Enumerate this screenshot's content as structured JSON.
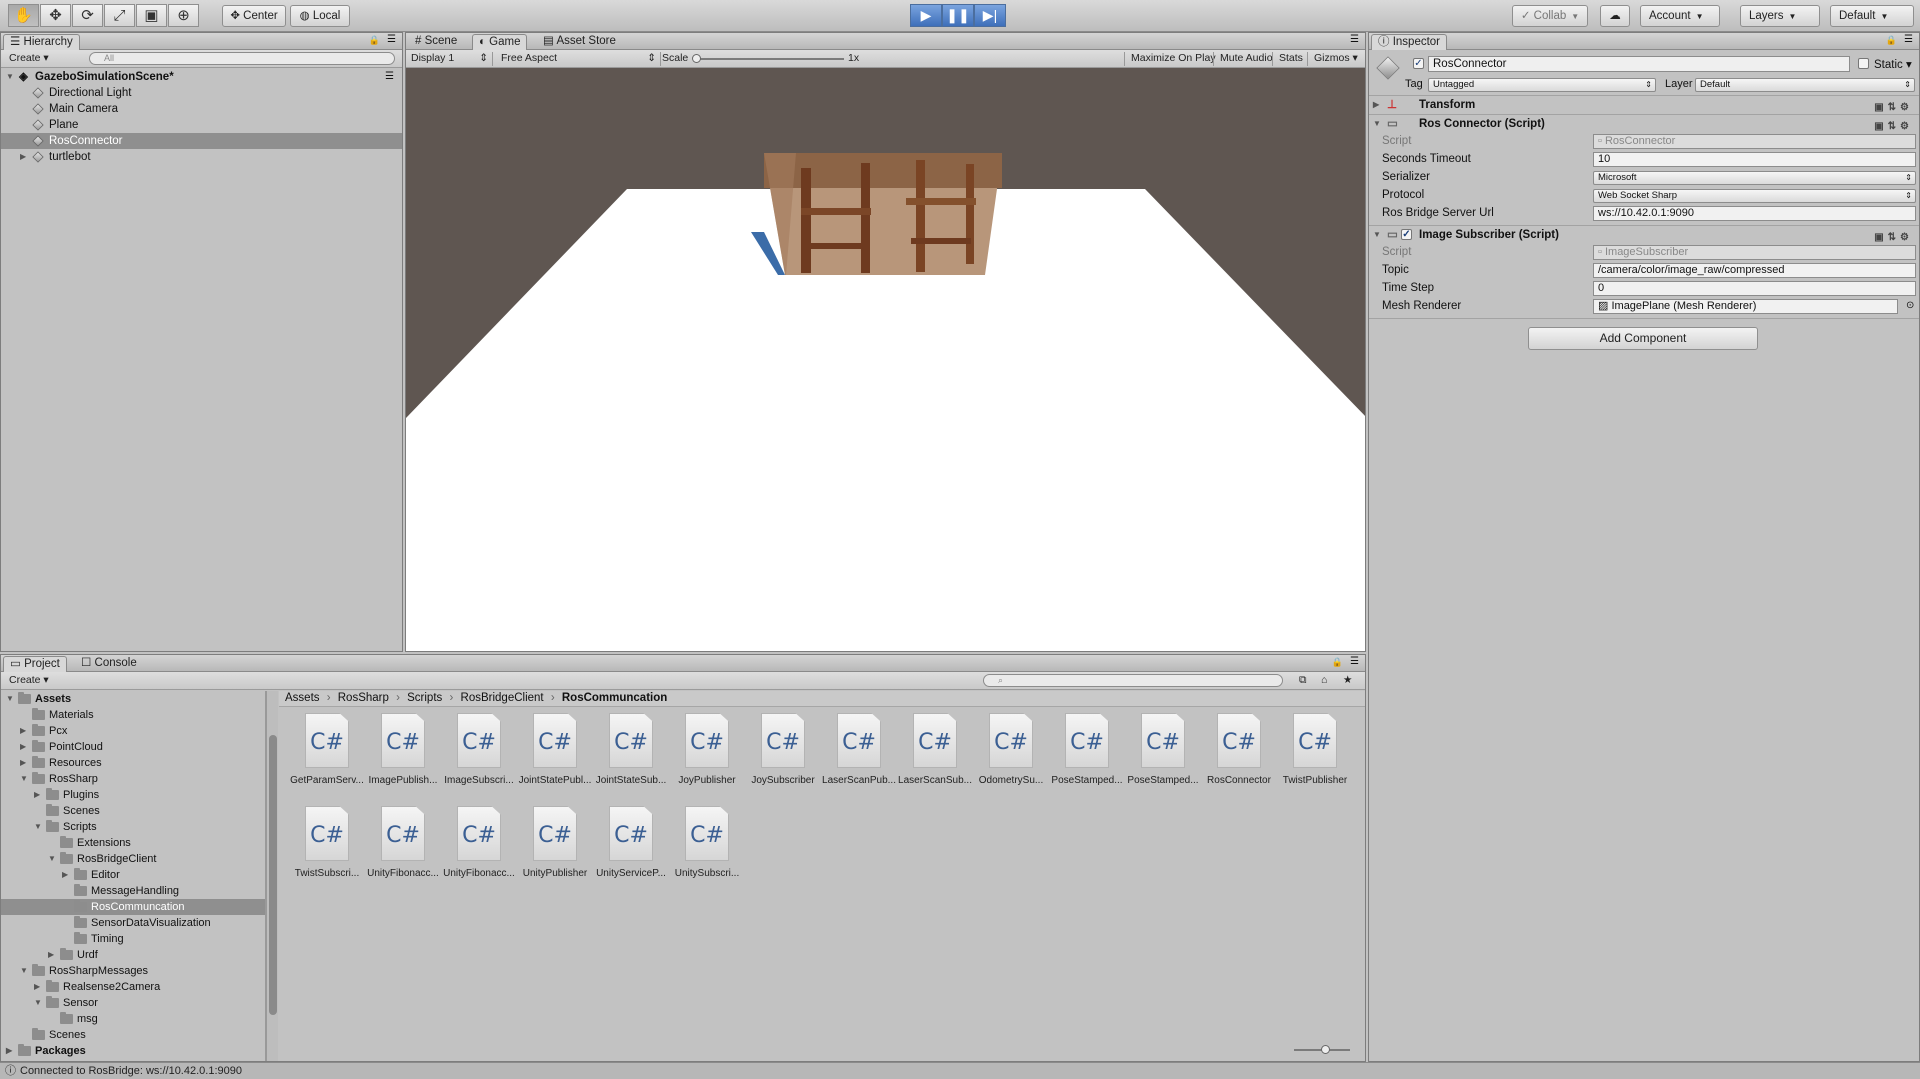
{
  "toolbar": {
    "center_label": "Center",
    "local_label": "Local",
    "collab_label": "Collab",
    "account_label": "Account",
    "layers_label": "Layers",
    "layout_label": "Default",
    "tools": [
      "hand-tool-icon",
      "move-tool-icon",
      "rotate-tool-icon",
      "scale-tool-icon",
      "rect-tool-icon",
      "transform-tool-icon"
    ]
  },
  "hierarchy": {
    "tab_label": "Hierarchy",
    "create_label": "Create",
    "search_placeholder": "All",
    "scene_name": "GazeboSimulationScene*",
    "items": [
      "Directional Light",
      "Main Camera",
      "Plane",
      "RosConnector",
      "turtlebot"
    ],
    "selected": "RosConnector"
  },
  "center": {
    "tabs": [
      "Scene",
      "Game",
      "Asset Store"
    ],
    "active_tab": "Game",
    "display_label": "Display 1",
    "aspect_label": "Free Aspect",
    "scale_label": "Scale",
    "scale_value": "1x",
    "buttons": [
      "Maximize On Play",
      "Mute Audio",
      "Stats",
      "Gizmos"
    ]
  },
  "inspector": {
    "tab_label": "Inspector",
    "object_name": "RosConnector",
    "static_label": "Static",
    "tag_label": "Tag",
    "tag_value": "Untagged",
    "layer_label": "Layer",
    "layer_value": "Default",
    "transform_label": "Transform",
    "ros_connector": {
      "title": "Ros Connector (Script)",
      "script_label": "Script",
      "script_value": "RosConnector",
      "timeout_label": "Seconds Timeout",
      "timeout_value": "10",
      "serializer_label": "Serializer",
      "serializer_value": "Microsoft",
      "protocol_label": "Protocol",
      "protocol_value": "Web Socket Sharp",
      "url_label": "Ros Bridge Server Url",
      "url_value": "ws://10.42.0.1:9090"
    },
    "image_subscriber": {
      "title": "Image Subscriber (Script)",
      "script_label": "Script",
      "script_value": "ImageSubscriber",
      "topic_label": "Topic",
      "topic_value": "/camera/color/image_raw/compressed",
      "timestep_label": "Time Step",
      "timestep_value": "0",
      "mesh_label": "Mesh Renderer",
      "mesh_value": "ImagePlane (Mesh Renderer)"
    },
    "add_component_label": "Add Component"
  },
  "project": {
    "tabs": [
      "Project",
      "Console"
    ],
    "create_label": "Create",
    "breadcrumb": [
      "Assets",
      "RosSharp",
      "Scripts",
      "RosBridgeClient",
      "RosCommuncation"
    ],
    "tree": [
      {
        "label": "Assets",
        "depth": 0,
        "open": true,
        "bold": true
      },
      {
        "label": "Materials",
        "depth": 1
      },
      {
        "label": "Pcx",
        "depth": 1,
        "arrow": true
      },
      {
        "label": "PointCloud",
        "depth": 1,
        "arrow": true
      },
      {
        "label": "Resources",
        "depth": 1,
        "arrow": true
      },
      {
        "label": "RosSharp",
        "depth": 1,
        "open": true
      },
      {
        "label": "Plugins",
        "depth": 2,
        "arrow": true
      },
      {
        "label": "Scenes",
        "depth": 2
      },
      {
        "label": "Scripts",
        "depth": 2,
        "open": true
      },
      {
        "label": "Extensions",
        "depth": 3
      },
      {
        "label": "RosBridgeClient",
        "depth": 3,
        "open": true
      },
      {
        "label": "Editor",
        "depth": 4,
        "arrow": true
      },
      {
        "label": "MessageHandling",
        "depth": 4
      },
      {
        "label": "RosCommuncation",
        "depth": 4,
        "selected": true
      },
      {
        "label": "SensorDataVisualization",
        "depth": 4
      },
      {
        "label": "Timing",
        "depth": 4
      },
      {
        "label": "Urdf",
        "depth": 3,
        "arrow": true
      },
      {
        "label": "RosSharpMessages",
        "depth": 1,
        "open": true
      },
      {
        "label": "Realsense2Camera",
        "depth": 2,
        "arrow": true
      },
      {
        "label": "Sensor",
        "depth": 2,
        "open": true
      },
      {
        "label": "msg",
        "depth": 3
      },
      {
        "label": "Scenes",
        "depth": 1
      },
      {
        "label": "Packages",
        "depth": 0,
        "arrow": true,
        "bold": true
      }
    ],
    "assets": [
      "GetParamServ...",
      "ImagePublish...",
      "ImageSubscri...",
      "JointStatePubl...",
      "JointStateSub...",
      "JoyPublisher",
      "JoySubscriber",
      "LaserScanPub...",
      "LaserScanSub...",
      "OdometrySu...",
      "PoseStamped...",
      "PoseStamped...",
      "RosConnector",
      "TwistPublisher",
      "TwistSubscri...",
      "UnityFibonacc...",
      "UnityFibonacc...",
      "UnityPublisher",
      "UnityServiceP...",
      "UnitySubscri..."
    ],
    "asset_glyph": "C#"
  },
  "status": {
    "text": "Connected to RosBridge: ws://10.42.0.1:9090"
  }
}
